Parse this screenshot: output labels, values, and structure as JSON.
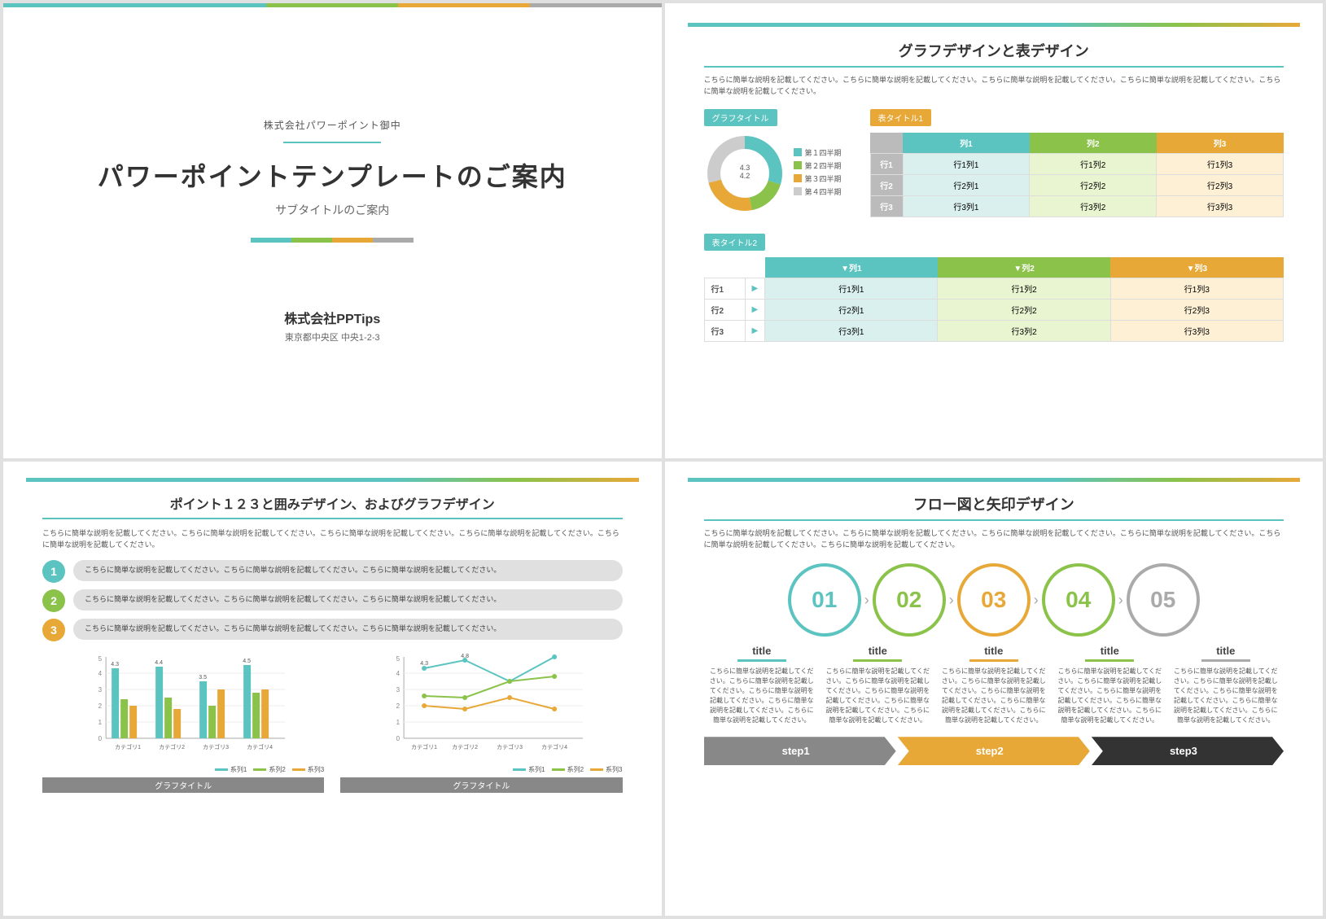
{
  "slide1": {
    "company_small": "株式会社パワーポイント御中",
    "title": "パワーポイントテンプレートのご案内",
    "subtitle": "サブタイトルのご案内",
    "company_large": "株式会社PPTips",
    "address": "東京都中央区 中央1-2-3",
    "divider_colors": [
      "#5bc4c0",
      "#8bc34a",
      "#e8a838",
      "#aaa"
    ],
    "topbar_colors": [
      "#5bc4c0",
      "#5bc4c0",
      "#8bc34a",
      "#e8a838",
      "#aaa"
    ]
  },
  "slide2": {
    "title": "グラフデザインと表デザイン",
    "desc": "こちらに簡単な説明を記載してください。こちらに簡単な説明を記載してください。こちらに簡単な説明を記載してください。こちらに簡単な説明を記載してください。こちらに簡単な説明を記載してください。",
    "graph_label": "グラフタイトル",
    "table1_label": "表タイトル1",
    "table2_label": "表タイトル2",
    "donut": {
      "legend": [
        {
          "label": "第１四半期",
          "color": "#5bc4c0",
          "value": "4.3"
        },
        {
          "label": "第２四半期",
          "color": "#8bc34a",
          "value": "2.5"
        },
        {
          "label": "第３四半期",
          "color": "#e8a838",
          "value": "3.5"
        },
        {
          "label": "第４四半期",
          "color": "#bbb",
          "value": "4.2"
        }
      ]
    },
    "table1": {
      "headers": [
        "",
        "列1",
        "列2",
        "列3"
      ],
      "rows": [
        [
          "行1",
          "行1列1",
          "行1列2",
          "行1列3"
        ],
        [
          "行2",
          "行2列1",
          "行2列2",
          "行2列3"
        ],
        [
          "行3",
          "行3列1",
          "行3列2",
          "行3列3"
        ]
      ]
    },
    "table2": {
      "headers": [
        "",
        "",
        "▼列1",
        "▼列2",
        "▼列3"
      ],
      "rows": [
        [
          "行1",
          "▶",
          "行1列1",
          "行1列2",
          "行1列3"
        ],
        [
          "行2",
          "▶",
          "行2列1",
          "行2列2",
          "行2列3"
        ],
        [
          "行3",
          "▶",
          "行3列1",
          "行3列2",
          "行3列3"
        ]
      ]
    }
  },
  "slide3": {
    "title": "ポイント１２３と囲みデザイン、およびグラフデザイン",
    "desc": "こちらに簡単な説明を記載してください。こちらに簡単な説明を記載してください。こちらに簡単な説明を記載してください。こちらに簡単な説明を記載してください。こちらに簡単な説明を記載してください。",
    "points": [
      {
        "num": "1",
        "color": "#5bc4c0",
        "text": "こちらに簡単な説明を記載してください。こちらに簡単な説明を記載してください。こちらに簡単な説明を記載してください。"
      },
      {
        "num": "2",
        "color": "#8bc34a",
        "text": "こちらに簡単な説明を記載してください。こちらに簡単な説明を記載してください。こちらに簡単な説明を記載してください。"
      },
      {
        "num": "3",
        "color": "#e8a838",
        "text": "こちらに簡単な説明を記載してください。こちらに簡単な説明を記載してください。こちらに簡単な説明を記載してください。"
      }
    ],
    "bar_chart_title": "グラフタイトル",
    "line_chart_title": "グラフタイトル",
    "bar_data": {
      "categories": [
        "カテゴリ1",
        "カテゴリ2",
        "カテゴリ3",
        "カテゴリ4"
      ],
      "series": [
        {
          "name": "系列1",
          "color": "#5bc4c0",
          "values": [
            4.3,
            4.4,
            3.5,
            4.5
          ]
        },
        {
          "name": "系列2",
          "color": "#8bc34a",
          "values": [
            2.4,
            2.5,
            2,
            2.8
          ]
        },
        {
          "name": "系列3",
          "color": "#e8a838",
          "values": [
            2,
            1.8,
            3,
            3
          ]
        }
      ]
    },
    "line_data": {
      "categories": [
        "カテゴリ1",
        "カテゴリ2",
        "カテゴリ3",
        "カテゴリ4"
      ],
      "series": [
        {
          "name": "系列1",
          "color": "#5bc4c0",
          "values": [
            4.3,
            4.8,
            3.5,
            5
          ]
        },
        {
          "name": "系列2",
          "color": "#8bc34a",
          "values": [
            2.6,
            2.5,
            3.5,
            3.8
          ]
        },
        {
          "name": "系列3",
          "color": "#e8a838",
          "values": [
            2,
            1.8,
            2.5,
            1.8
          ]
        }
      ]
    }
  },
  "slide4": {
    "title": "フロー図と矢印デザイン",
    "desc": "こちらに簡単な説明を記載してください。こちらに簡単な説明を記載してください。こちらに簡単な説明を記載してください。こちらに簡単な説明を記載してください。こちらに簡単な説明を記載してください。こちらに簡単な説明を記載してください。",
    "circles": [
      {
        "num": "01",
        "color": "#5bc4c0"
      },
      {
        "num": "02",
        "color": "#8bc34a"
      },
      {
        "num": "03",
        "color": "#e8a838"
      },
      {
        "num": "04",
        "color": "#8bc34a"
      },
      {
        "num": "05",
        "color": "#aaa"
      }
    ],
    "flow_items": [
      {
        "title": "title",
        "line_color": "#5bc4c0",
        "desc": "こちらに簡単な説明を記載してください。こちらに簡単な説明を記載してください。こちらに簡単な説明を記載してください。こちらに簡単な説明を記載してください。こちらに簡単な説明を記載してください。"
      },
      {
        "title": "title",
        "line_color": "#8bc34a",
        "desc": "こちらに簡単な説明を記載してください。こちらに簡単な説明を記載してください。こちらに簡単な説明を記載してください。こちらに簡単な説明を記載してください。こちらに簡単な説明を記載してください。"
      },
      {
        "title": "title",
        "line_color": "#e8a838",
        "desc": "こちらに簡単な説明を記載してください。こちらに簡単な説明を記載してください。こちらに簡単な説明を記載してください。こちらに簡単な説明を記載してください。こちらに簡単な説明を記載してください。"
      },
      {
        "title": "title",
        "line_color": "#8bc34a",
        "desc": "こちらに簡単な説明を記載してください。こちらに簡単な説明を記載してください。こちらに簡単な説明を記載してください。こちらに簡単な説明を記載してください。こちらに簡単な説明を記載してください。"
      },
      {
        "title": "title",
        "line_color": "#aaa",
        "desc": "こちらに簡単な説明を記載してください。こちらに簡単な説明を記載してください。こちらに簡単な説明を記載してください。こちらに簡単な説明を記載してください。こちらに簡単な説明を記載してください。"
      }
    ],
    "steps": [
      {
        "label": "step1",
        "color": "#888"
      },
      {
        "label": "step2",
        "color": "#e8a838"
      },
      {
        "label": "step3",
        "color": "#333"
      }
    ]
  },
  "thumbnails": [
    {
      "num": "01 title"
    },
    {
      "num": "02 title"
    },
    {
      "num": "03 title"
    },
    {
      "num": "04 title"
    }
  ]
}
